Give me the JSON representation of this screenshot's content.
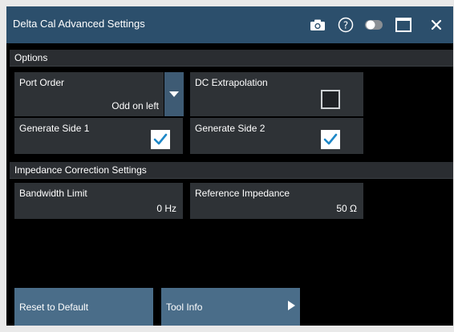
{
  "window": {
    "title": "Delta Cal Advanced Settings",
    "icons": [
      "camera-icon",
      "help-icon",
      "toggle-icon",
      "maximize-icon",
      "close-icon"
    ]
  },
  "options": {
    "section_label": "Options",
    "port_order": {
      "label": "Port Order",
      "value": "Odd on left"
    },
    "dc_extrapolation": {
      "label": "DC Extrapolation",
      "checked": false
    },
    "generate_side_1": {
      "label": "Generate Side 1",
      "checked": true
    },
    "generate_side_2": {
      "label": "Generate Side 2",
      "checked": true
    }
  },
  "impedance": {
    "section_label": "Impedance Correction Settings",
    "bandwidth_limit": {
      "label": "Bandwidth Limit",
      "value": "0 Hz"
    },
    "reference_impedance": {
      "label": "Reference Impedance",
      "value": "50 Ω"
    }
  },
  "buttons": {
    "reset_label": "Reset to Default",
    "tool_info_label": "Tool Info"
  },
  "colors": {
    "titlebar": "#2c4f6c",
    "field_bg": "#2e3236",
    "button_bg": "#4a6d89",
    "check_blue": "#1e88c8"
  }
}
